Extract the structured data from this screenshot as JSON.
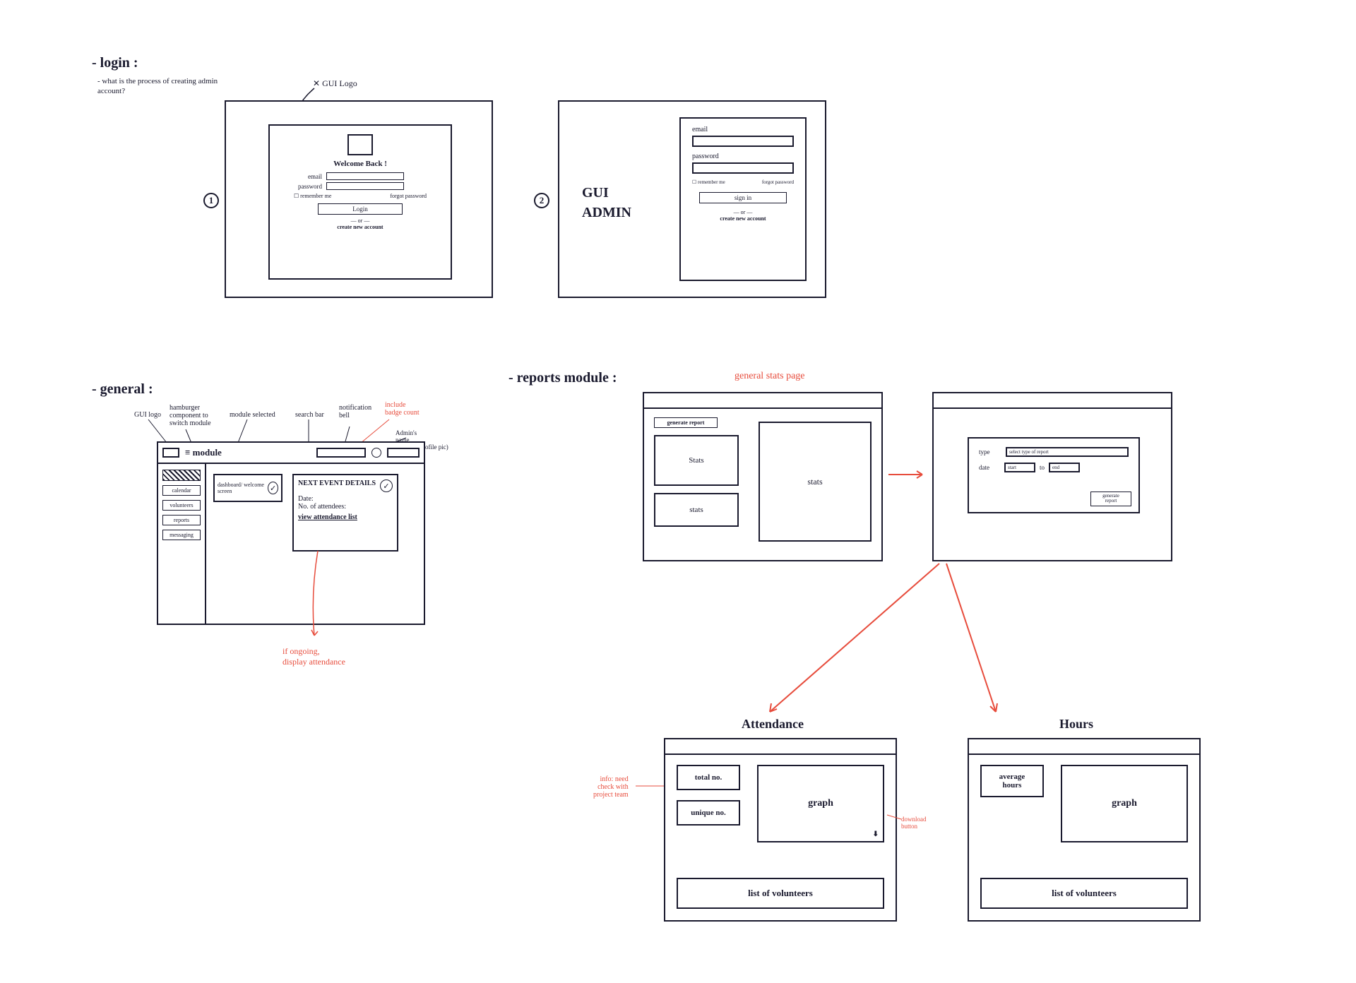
{
  "sections": {
    "login": {
      "title": "- login :",
      "subnote": "- what is the process of creating admin account?",
      "gui_logo_label": "GUI Logo",
      "step1": {
        "num": "①",
        "welcome": "Welcome Back !",
        "email_label": "email",
        "password_label": "password",
        "remember": "☐ remember me",
        "forgot": "forgot password",
        "login_btn": "Login",
        "or": "— or —",
        "create": "create new account"
      },
      "step2": {
        "num": "②",
        "brand": "GUI\nADMIN",
        "email_label": "email",
        "password_label": "password",
        "remember": "☐ remember me",
        "forgot": "forgot password",
        "signin_btn": "sign in",
        "or": "— or —",
        "create": "create new account"
      }
    },
    "general": {
      "title": "- general :",
      "annotations": {
        "logo": "GUI logo",
        "hamburger": "hamburger\ncomponent to\nswitch module",
        "module_selected": "module selected",
        "search_bar": "search bar",
        "notif": "notification\nbell",
        "badge_count": "include\nbadge count",
        "admin_name": "Admin's\nname\n(banner / profile pic)"
      },
      "header_module": "≡ module",
      "sidebar": [
        "calendar",
        "volunteers",
        "reports",
        "messaging"
      ],
      "dashboard_card": "dashboard/\nwelcome screen",
      "next_event": {
        "title": "NEXT EVENT DETAILS",
        "date": "Date:",
        "attendees": "No. of attendees:",
        "view": "view attendance list"
      },
      "ongoing_note": "if ongoing,\ndisplay attendance"
    },
    "reports": {
      "title": "- reports module :",
      "subtitle": "general stats page",
      "stats_page": {
        "generate_btn": "generate report",
        "stats1": "Stats",
        "stats2": "stats",
        "stats_big": "stats"
      },
      "generate_modal": {
        "type_label": "type",
        "type_value": "select type of report",
        "date_label": "date",
        "date_from": "start",
        "date_to": "end",
        "to_word": "to",
        "go_btn": "generate\nreport"
      },
      "attendance": {
        "title": "Attendance",
        "info_note": "info: need\ncheck with\nproject team",
        "total": "total no.",
        "unique": "unique no.",
        "graph": "graph",
        "download_note": "download\nbutton",
        "list": "list of volunteers"
      },
      "hours": {
        "title": "Hours",
        "avg": "average\nhours",
        "graph": "graph",
        "list": "list of volunteers"
      }
    }
  }
}
